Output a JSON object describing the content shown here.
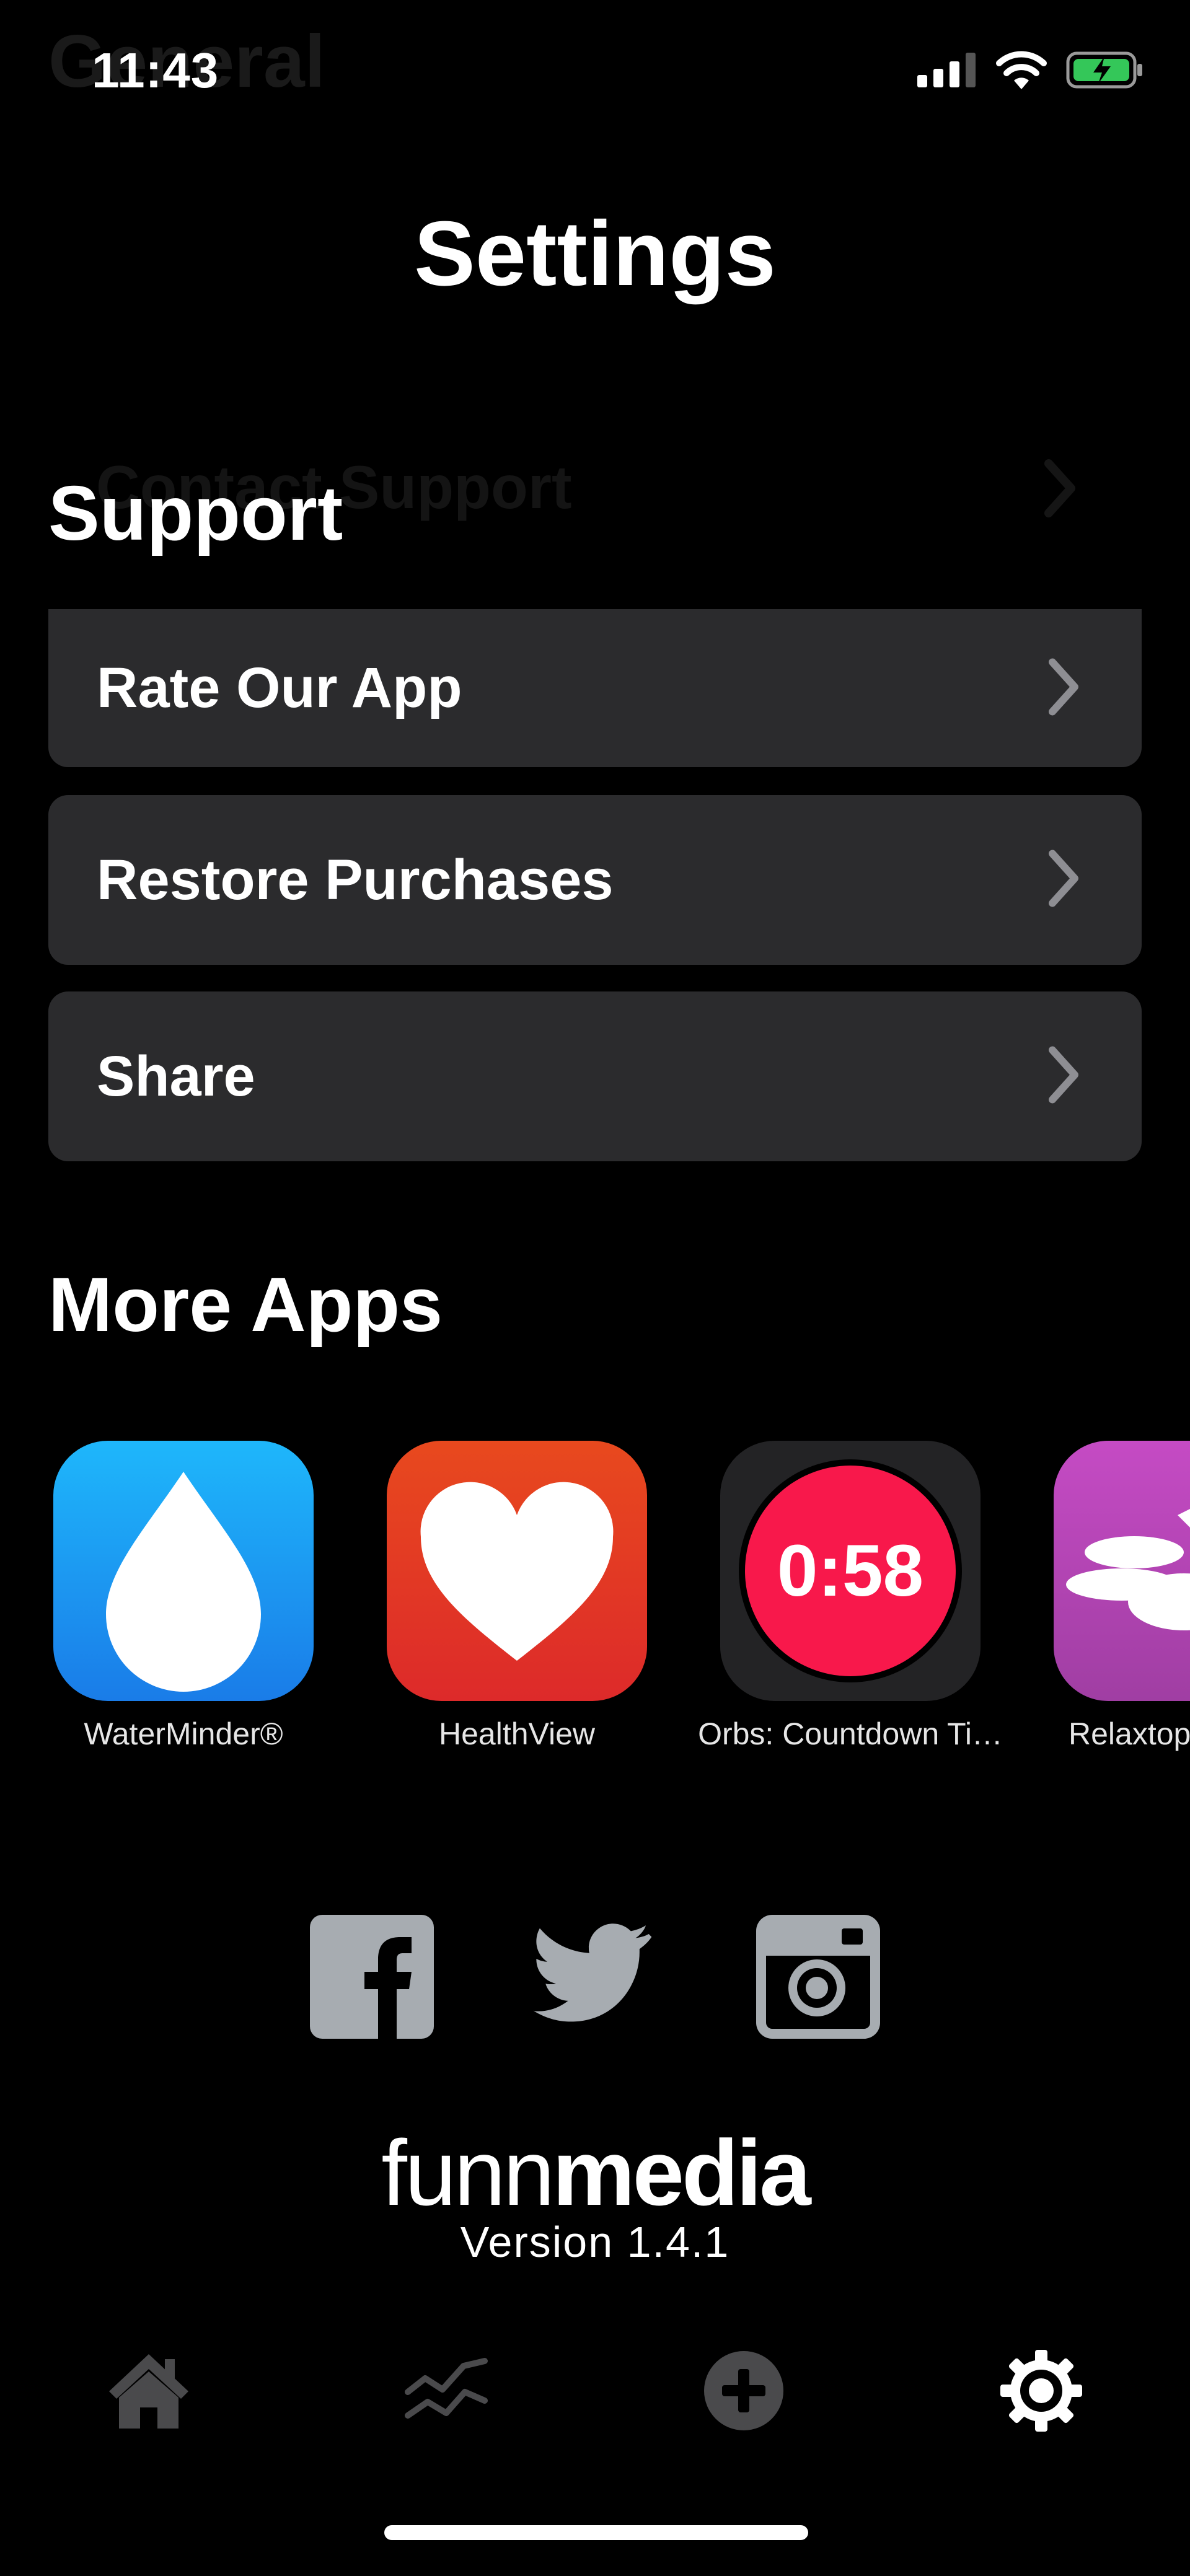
{
  "status_bar": {
    "time": "11:43",
    "ghost_header": "General"
  },
  "page": {
    "title": "Settings"
  },
  "support": {
    "title": "Support",
    "ghost_row": "Contact Support",
    "rows": [
      {
        "label": "Rate Our App"
      },
      {
        "label": "Restore Purchases"
      },
      {
        "label": "Share"
      }
    ]
  },
  "more_apps": {
    "title": "More Apps",
    "apps": [
      {
        "name": "WaterMinder®",
        "icon": "water-drop-icon"
      },
      {
        "name": "HealthView",
        "icon": "heart-icon"
      },
      {
        "name": "Orbs: Countdown Ti…",
        "icon": "countdown-orb-icon",
        "icon_text": "0:58"
      },
      {
        "name": "Relaxtop",
        "icon": "zen-stones-icon"
      }
    ]
  },
  "socials": [
    {
      "icon": "facebook-icon"
    },
    {
      "icon": "twitter-icon"
    },
    {
      "icon": "instagram-icon"
    }
  ],
  "brand": {
    "thin": "funn",
    "bold": "media"
  },
  "version": "Version 1.4.1",
  "tabs": [
    {
      "icon": "home-icon",
      "active": false
    },
    {
      "icon": "chart-lines-icon",
      "active": false
    },
    {
      "icon": "add-circle-icon",
      "active": false
    },
    {
      "icon": "gear-icon",
      "active": true
    }
  ],
  "colors": {
    "background": "#000000",
    "row_background": "#2b2b2d",
    "chevron": "#8e8e93",
    "inactive_tab": "#4a4a4c",
    "active_tab": "#ffffff",
    "social_icon": "#a7acb1",
    "battery": "#34c759"
  }
}
